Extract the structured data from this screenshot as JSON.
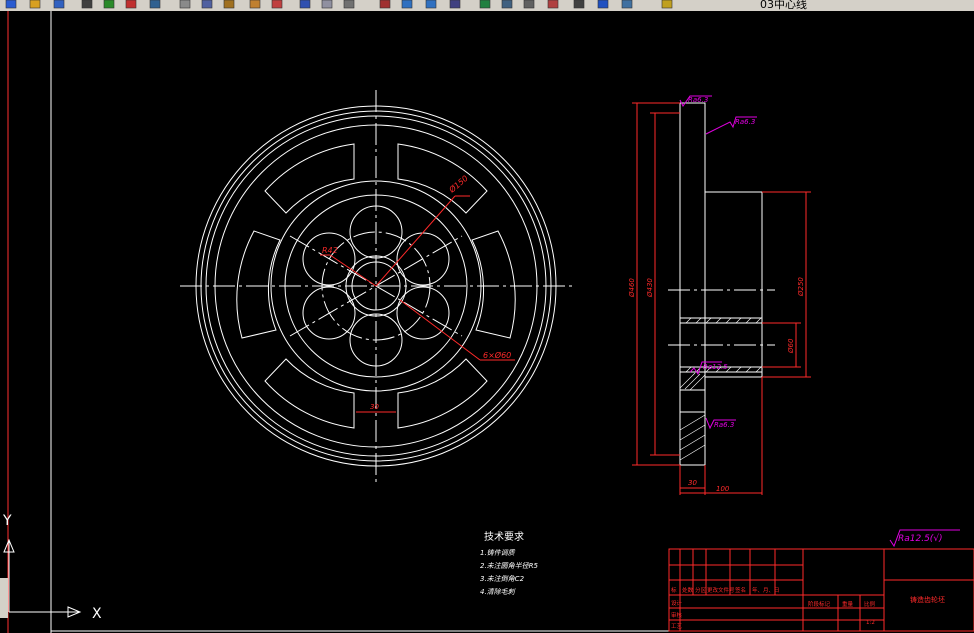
{
  "toolbar": {
    "layer_name": "03中心线",
    "icons": [
      "new-icon",
      "open-icon",
      "save-icon",
      "print-icon",
      "preview-icon",
      "publish-icon",
      "plot-icon",
      "cut-icon",
      "copy-icon",
      "paste-icon",
      "match-properties-icon",
      "brush-icon",
      "undo-icon",
      "redo-icon",
      "pan-icon",
      "zoom-realtime-icon",
      "zoom-window-icon",
      "zoom-previous-icon",
      "properties-icon",
      "design-center-icon",
      "tool-palettes-icon",
      "sheet-set-icon",
      "markup-icon",
      "calculator-icon",
      "help-icon",
      "layer-manager-icon",
      "layer-state-icon"
    ]
  },
  "front_view": {
    "dim_pitch_circle": "Ø150",
    "dim_hole_radius": "R42",
    "dim_holes": "6×Ø60",
    "dim_rib": "30"
  },
  "side_view": {
    "roughness_top": "Ra6.3",
    "roughness_face": "Ra6.3",
    "roughness_mid": "Ra12.5",
    "roughness_bottom": "Ra6.3",
    "dim_outer": "Ø460",
    "dim_inner": "Ø430",
    "dim_hub": "Ø250",
    "dim_bore": "Ø60",
    "dim_rim_width": "30",
    "dim_total_width": "100"
  },
  "general_roughness": "Ra12.5(√)",
  "tech_requirements": {
    "title": "技术要求",
    "items": [
      "1.铸件调质",
      "2.未注圆角半径R5",
      "3.未注倒角C2",
      "4.清除毛刺"
    ]
  },
  "title_block": {
    "cells": [
      "标",
      "处数",
      "分区",
      "更改文件号",
      "签名",
      "年、月、日",
      "设计",
      "审核",
      "工艺",
      "阶段标记",
      "重量",
      "比例"
    ],
    "drawing_name": "铸造齿轮坯",
    "scale": "1:2"
  }
}
